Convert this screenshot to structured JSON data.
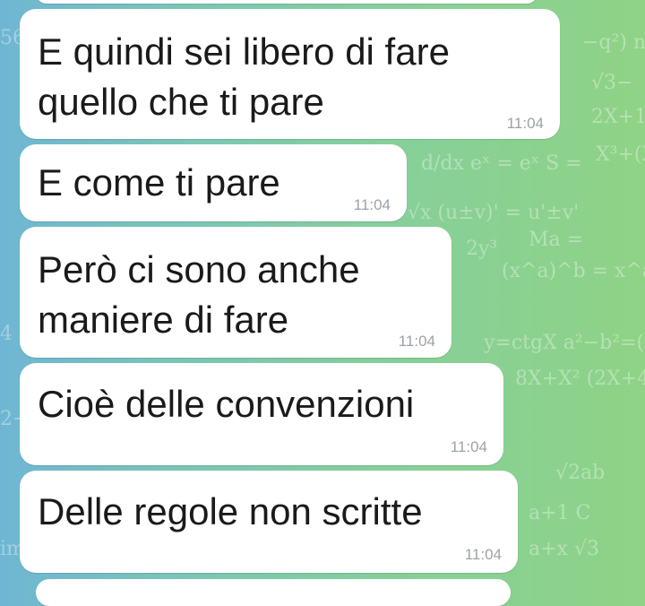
{
  "messages": [
    {
      "text": "E quindi sei libero di fare\nquello che ti pare",
      "time": "11:04"
    },
    {
      "text": "E come ti pare",
      "time": "11:04"
    },
    {
      "text": "Però ci sono anche\nmaniere di fare",
      "time": "11:04"
    },
    {
      "text": "Cioè delle convenzioni",
      "time": "11:04"
    },
    {
      "text": "Delle regole non scritte",
      "time": "11:04"
    }
  ],
  "theme": {
    "bubble": "#ffffff",
    "time": "#9aa3a8",
    "text": "#1a1a1a"
  }
}
